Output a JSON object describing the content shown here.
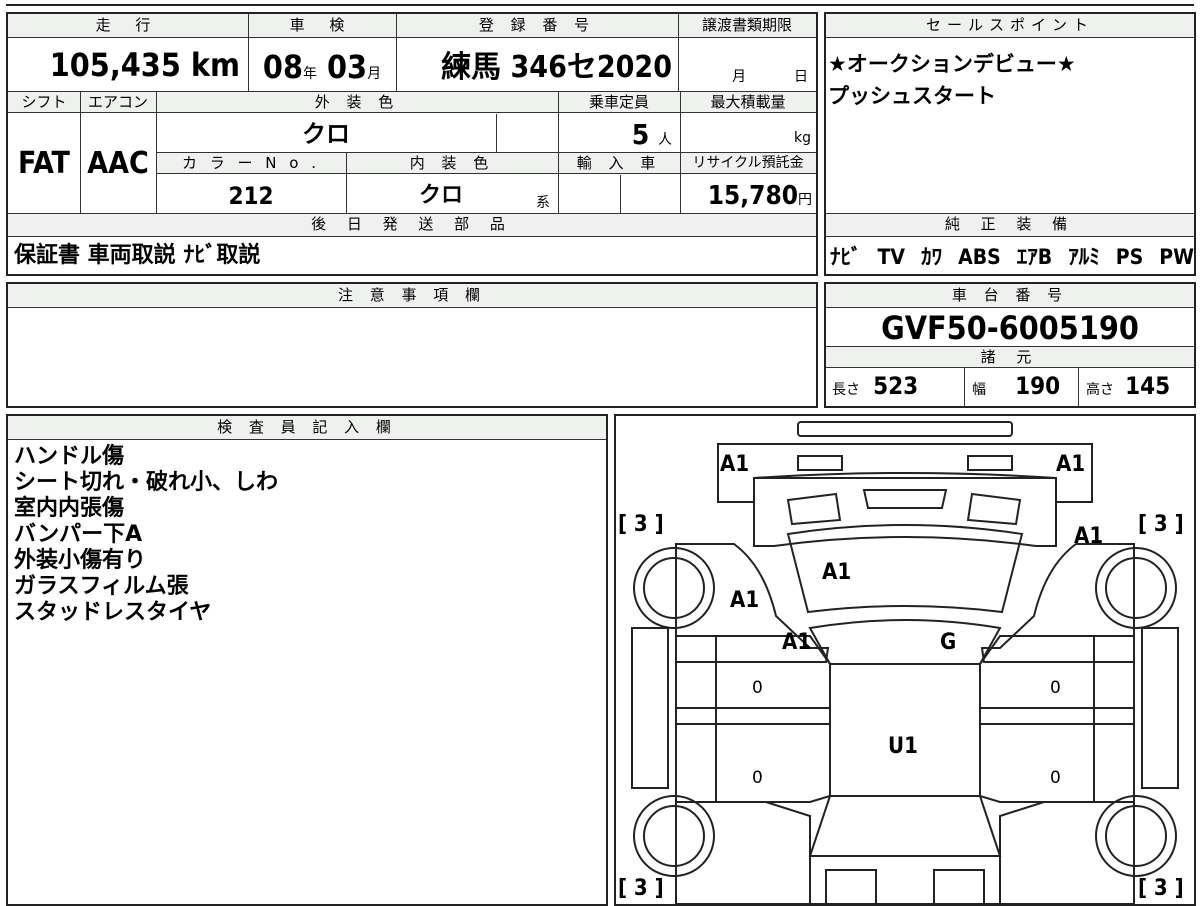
{
  "mileage": {
    "header": "走 行",
    "value": "105,435",
    "unit": "km"
  },
  "inspection": {
    "header": "車 検",
    "year": "08",
    "year_unit": "年",
    "month": "03",
    "month_unit": "月"
  },
  "registration": {
    "header": "登 録 番 号",
    "value": "練馬 346セ2020"
  },
  "transfer": {
    "header": "譲渡書類期限",
    "month_label": "月",
    "day_label": "日"
  },
  "shift": {
    "header": "シフト",
    "value": "FAT"
  },
  "aircon": {
    "header": "エアコン",
    "value": "AAC"
  },
  "exterior_color": {
    "header": "外 装 色",
    "value": "クロ"
  },
  "capacity": {
    "header": "乗車定員",
    "value": "5",
    "unit": "人"
  },
  "max_load": {
    "header": "最大積載量",
    "unit": "kg"
  },
  "color_no": {
    "header": "カ ラ ー N o .",
    "value": "212"
  },
  "interior_color": {
    "header": "内 装 色",
    "value": "クロ",
    "suffix": "系"
  },
  "import": {
    "header": "輸 入 車"
  },
  "recycle": {
    "header": "リサイクル預託金",
    "value": "15,780",
    "unit": "円"
  },
  "later_parts": {
    "header": "後 日 発 送 部 品",
    "value": "保証書 車両取説 ﾅﾋﾞ取説"
  },
  "sales_points": {
    "header": "セールスポイント",
    "lines": [
      "★オークションデビュー★",
      "プッシュスタート"
    ]
  },
  "equipment": {
    "header": "純 正 装 備",
    "items": [
      "ﾅﾋﾞ",
      "TV",
      "ｶﾜ",
      "ABS",
      "ｴｱB",
      "ｱﾙﾐ",
      "PS",
      "PW"
    ]
  },
  "caution": {
    "header": "注 意 事 項 欄"
  },
  "chassis": {
    "header": "車 台 番 号",
    "value": "GVF50-6005190"
  },
  "specs": {
    "header": "諸 元",
    "length_label": "長さ",
    "length": "523",
    "width_label": "幅",
    "width": "190",
    "height_label": "高さ",
    "height": "145"
  },
  "inspector": {
    "header": "検 査 員 記 入 欄",
    "notes": [
      "ハンドル傷",
      "シート切れ・破れ小、しわ",
      "室内内張傷",
      "バンパー下A",
      "外装小傷有り",
      "ガラスフィルム張",
      "スタッドレスタイヤ"
    ]
  },
  "diagram": {
    "marks": [
      "A1",
      "A1",
      "A1",
      "A1",
      "A1",
      "A1",
      "G",
      "U1"
    ],
    "tire_labels": [
      "[ 3 ]",
      "[ 3 ]",
      "[ 3 ]",
      "[ 3 ]"
    ],
    "zero_marks": [
      "0",
      "0",
      "0",
      "0"
    ]
  }
}
